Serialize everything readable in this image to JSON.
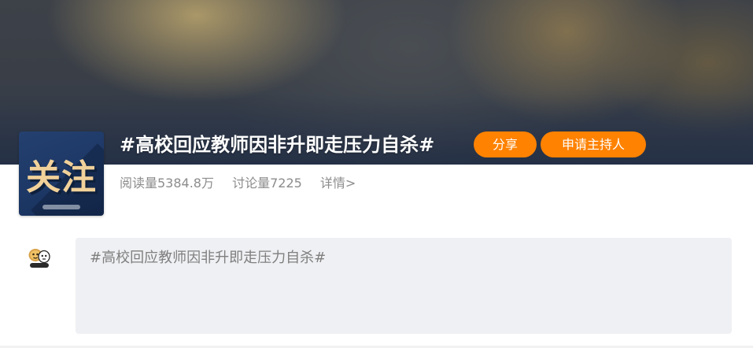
{
  "topic": {
    "title": "#高校回应教师因非升即走压力自杀#",
    "cover_text": "关注",
    "share_label": "分享",
    "host_label": "申请主持人",
    "read_count": "阅读量5384.8万",
    "discuss_count": "讨论量7225",
    "details_label": "详情>"
  },
  "composer": {
    "placeholder": "#高校回应教师因非升即走压力自杀#"
  },
  "colors": {
    "accent": "#ff8200",
    "cover_bg": "#1d3866",
    "cover_text": "#f1d19a"
  },
  "icons": {
    "avatar": "user-avatar-icon"
  }
}
